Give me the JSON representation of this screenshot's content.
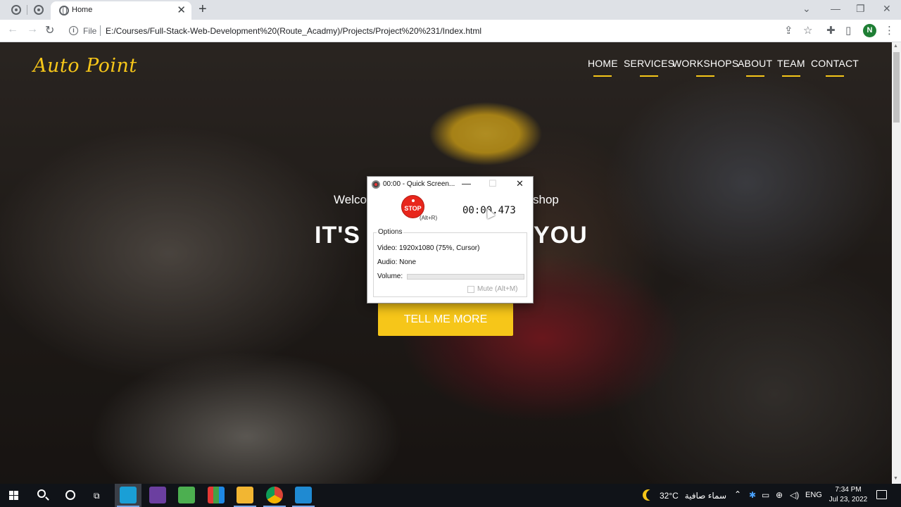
{
  "browser": {
    "tab_title": "Home",
    "tab_close": "✕",
    "new_tab": "+",
    "url_scheme": "File",
    "url": "E:/Courses/Full-Stack-Web-Development%20(Route_Acadmy)/Projects/Project%20%231/Index.html",
    "profile_initial": "N"
  },
  "page": {
    "brand": "Auto Point",
    "nav": [
      "HOME",
      "SERVICES",
      "WORKSHOPS",
      "ABOUT",
      "TEAM",
      "CONTACT"
    ],
    "hero_subtitle_start": "Welco",
    "hero_subtitle_end": "shop",
    "hero_title_start": "IT'S",
    "hero_title_end": "YOU",
    "cta_label": "TELL ME MORE",
    "colors": {
      "accent": "#f6c619"
    }
  },
  "recorder": {
    "title": "00:00 - Quick Screen...",
    "stop_label": "STOP",
    "shortcut": "(Alt+R)",
    "timer": "00:00.473",
    "options_label": "Options",
    "video": "Video: 1920x1080 (75%, Cursor)",
    "audio": "Audio: None",
    "volume_label": "Volume:",
    "volume_level": 0,
    "mute_label": "Mute (Alt+M)"
  },
  "taskbar": {
    "apps": [
      "screen-recorder",
      "visual-studio",
      "app-green",
      "app-multicolor",
      "file-explorer",
      "chrome",
      "vs-code"
    ],
    "weather_temp": "32°C",
    "weather_text": "سماء صافية",
    "language": "ENG",
    "time": "7:34 PM",
    "date": "Jul 23, 2022"
  }
}
